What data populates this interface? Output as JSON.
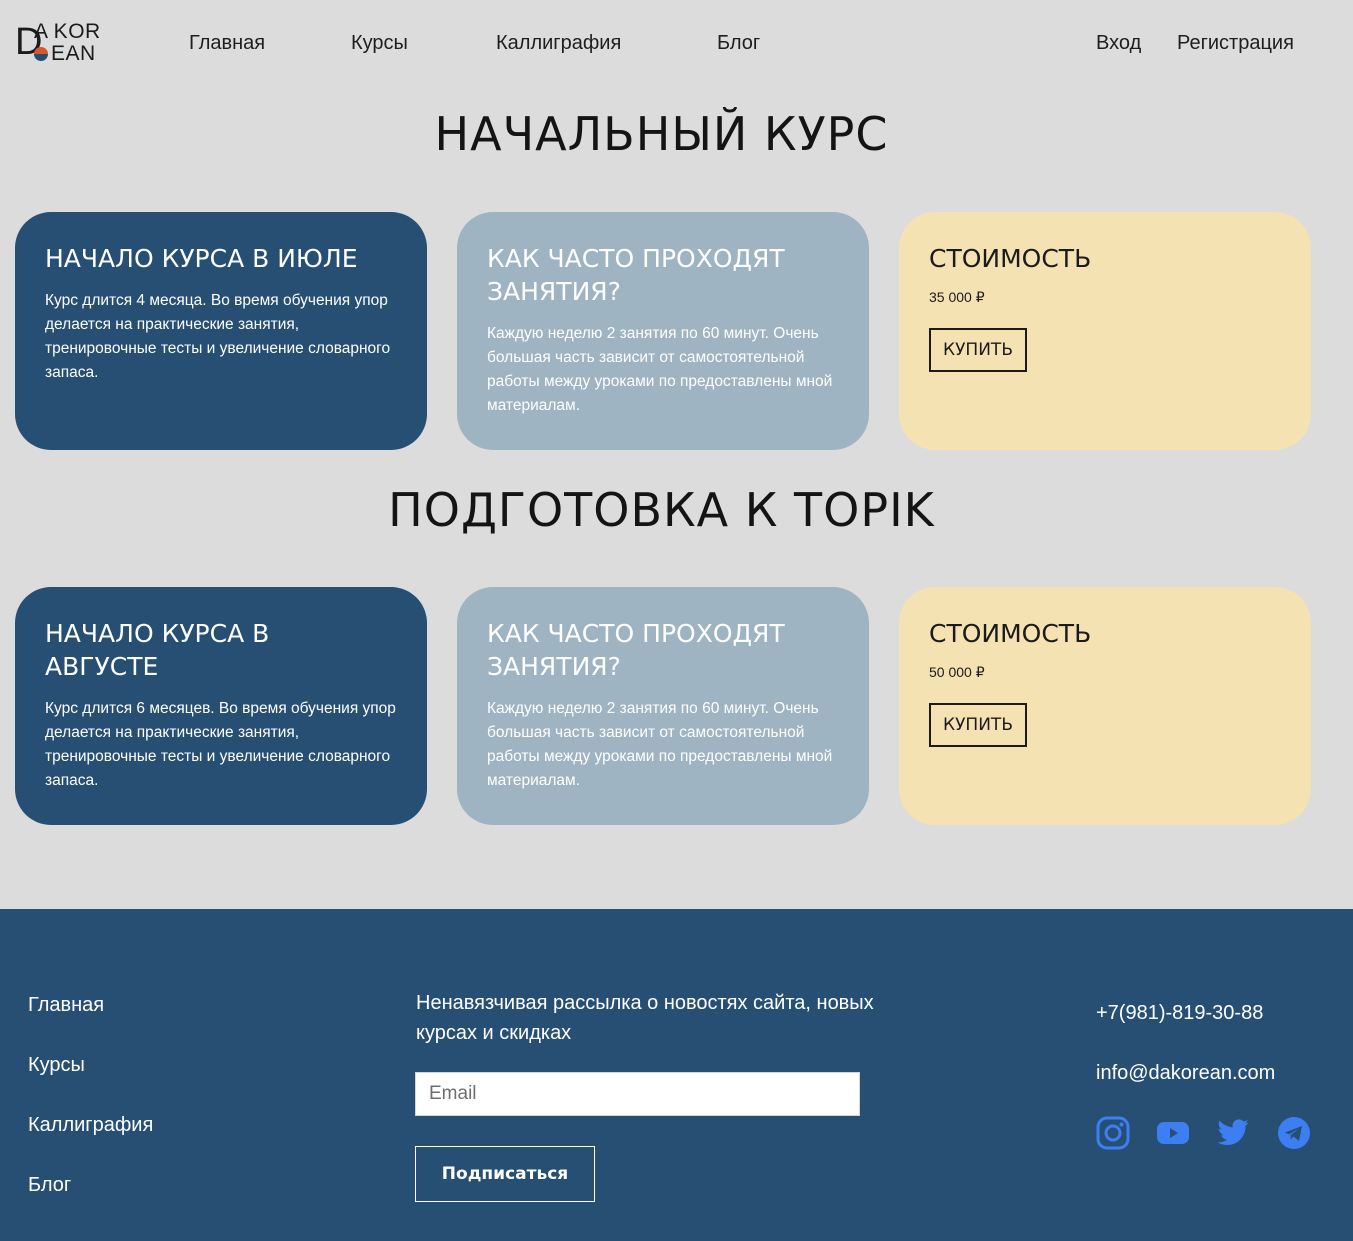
{
  "header": {
    "logo": {
      "letter_d": "D",
      "row1": "A KOR",
      "row2": "EAN"
    },
    "nav": [
      "Главная",
      "Курсы",
      "Каллиграфия",
      "Блог"
    ],
    "auth": {
      "login": "Вход",
      "register": "Регистрация"
    }
  },
  "sections": [
    {
      "title": "Начальный курс",
      "cards": [
        {
          "heading": "Начало курса в июле",
          "text": "Курс длится 4 месяца. Во время обучения упор делается на практические занятия, тренировочные тесты и увеличение словарного запаса."
        },
        {
          "heading": "Как часто проходят занятия?",
          "text": "Каждую неделю 2 занятия по 60 минут. Очень большая часть зависит от самостоятельной работы между уроками по предоставлены мной материалам."
        },
        {
          "heading": "Стоимость",
          "price": "35 000 ₽",
          "button": "Купить"
        }
      ]
    },
    {
      "title": "Подготовка к TOPIK",
      "cards": [
        {
          "heading": "Начало курса в августе",
          "text": "Курс длится 6 месяцев. Во время обучения упор делается на практические занятия, тренировочные тесты и увеличение словарного запаса."
        },
        {
          "heading": "Как часто проходят занятия?",
          "text": "Каждую неделю 2 занятия по 60 минут. Очень большая часть зависит от самостоятельной работы между уроками по предоставлены мной материалам."
        },
        {
          "heading": "Стоимость",
          "price": "50 000 ₽",
          "button": "Купить"
        }
      ]
    }
  ],
  "footer": {
    "nav": [
      "Главная",
      "Курсы",
      "Каллиграфия",
      "Блог"
    ],
    "newsletter_text": "Ненавязчивая рассылка о новостях сайта, новых курсах и скидках",
    "email_placeholder": "Email",
    "subscribe_label": "Подписаться",
    "phone": "+7(981)-819-30-88",
    "email": "info@dakorean.com",
    "social": [
      "instagram-icon",
      "youtube-icon",
      "twitter-icon",
      "telegram-icon"
    ],
    "social_color": "#3d7ff2"
  },
  "colors": {
    "background": "#dcdcdc",
    "dark_card": "#264f73",
    "grey_card": "#9fb4c2",
    "sand_card": "#f5e2b2",
    "footer": "#264f73",
    "logo_orange": "#d8582b"
  }
}
